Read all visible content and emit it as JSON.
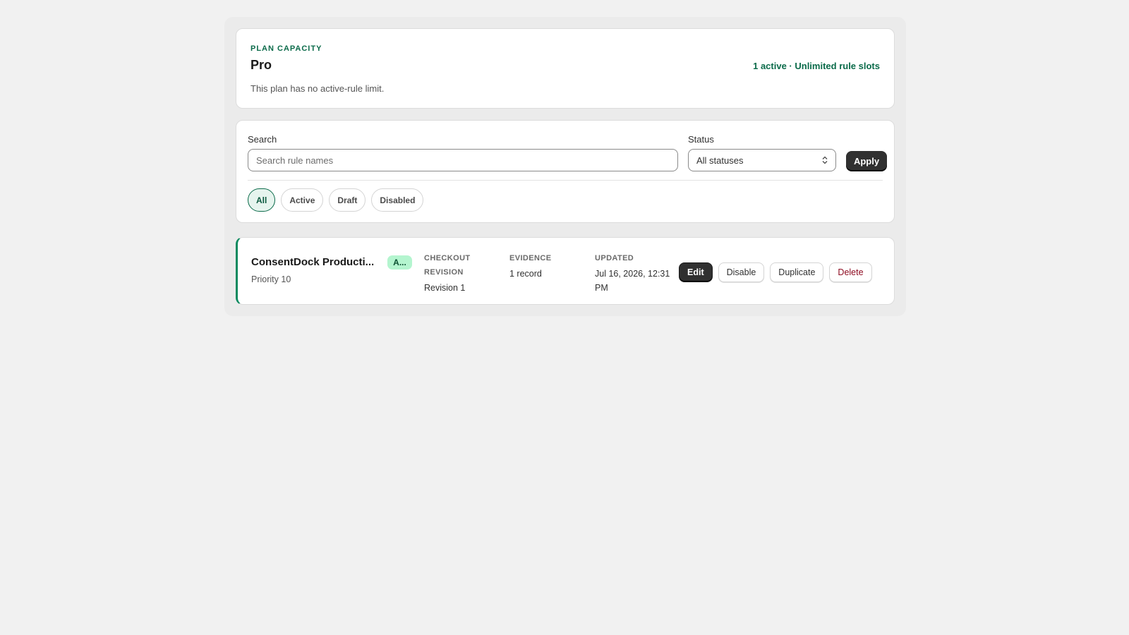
{
  "plan": {
    "eyebrow": "PLAN CAPACITY",
    "name": "Pro",
    "description": "This plan has no active-rule limit.",
    "summary": "1 active · Unlimited rule slots"
  },
  "filters": {
    "search_label": "Search",
    "search_placeholder": "Search rule names",
    "search_value": "",
    "status_label": "Status",
    "status_selected": "All statuses",
    "apply_label": "Apply",
    "chips": [
      {
        "label": "All",
        "selected": true
      },
      {
        "label": "Active",
        "selected": false
      },
      {
        "label": "Draft",
        "selected": false
      },
      {
        "label": "Disabled",
        "selected": false
      }
    ]
  },
  "rules": [
    {
      "name": "ConsentDock Producti...",
      "priority": "Priority 10",
      "status_badge": "A...",
      "checkout_head": "CHECKOUT REVISION",
      "checkout_value": "Revision 1",
      "evidence_head": "EVIDENCE",
      "evidence_value": "1 record",
      "updated_head": "UPDATED",
      "updated_value": "Jul 16, 2026, 12:31 PM",
      "actions": {
        "edit": "Edit",
        "disable": "Disable",
        "duplicate": "Duplicate",
        "delete": "Delete"
      }
    }
  ],
  "colors": {
    "accent_green": "#0b6b4a",
    "badge_bg": "#b4f5cf",
    "primary_button": "#303030",
    "danger_text": "#8e0b21",
    "page_bg": "#f1f1f1"
  }
}
